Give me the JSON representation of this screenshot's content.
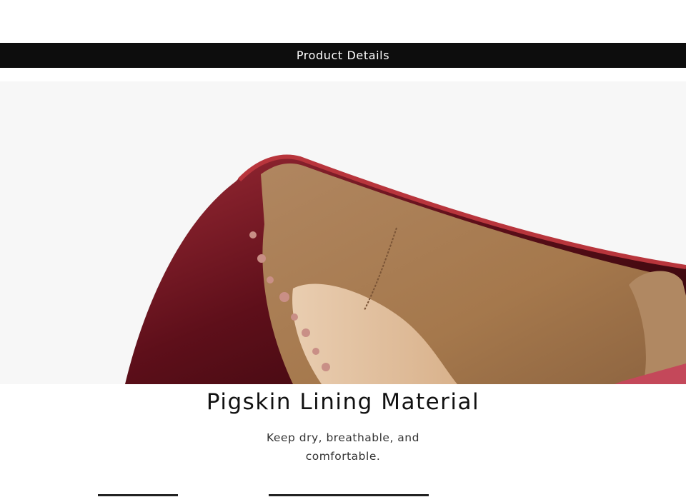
{
  "header": {
    "title": "Product Details"
  },
  "feature": {
    "title": "Pigskin Lining Material",
    "description": "Keep dry, breathable, and comfortable."
  },
  "colors": {
    "header_bg": "#0d0d0d",
    "leather_burgundy": "#6e1420",
    "lining_tan": "#a67c52"
  },
  "image": {
    "subject": "burgundy brogue shoe interior showing pigskin lining"
  }
}
